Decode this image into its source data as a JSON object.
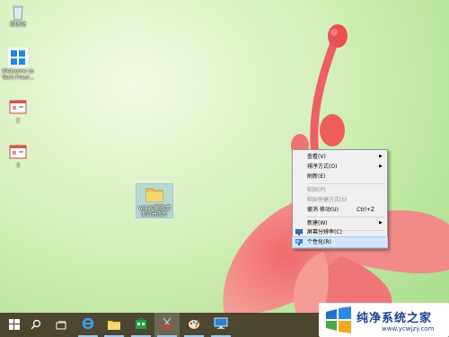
{
  "desktop": {
    "icons": [
      {
        "label": "回收站",
        "icon": "recycle-bin-icon"
      },
      {
        "label": "Welcome to Tech Previ...",
        "icon": "windows-logo-icon"
      },
      {
        "label": "2",
        "icon": "document-icon"
      },
      {
        "label": "3",
        "icon": "document-icon"
      },
      {
        "label": "win10更改桌面背景图片",
        "icon": "folder-icon"
      }
    ]
  },
  "context_menu": {
    "items": [
      {
        "label": "查看(V)",
        "submenu": true,
        "disabled": false
      },
      {
        "label": "排序方式(O)",
        "submenu": true,
        "disabled": false
      },
      {
        "label": "刷新(E)",
        "submenu": false,
        "disabled": false
      },
      {
        "label": "粘贴(P)",
        "submenu": false,
        "disabled": true
      },
      {
        "label": "粘贴快捷方式(S)",
        "submenu": false,
        "disabled": true
      },
      {
        "label": "撤消 移动(U)",
        "shortcut": "Ctrl+Z",
        "submenu": false,
        "disabled": false
      },
      {
        "label": "新建(W)",
        "submenu": true,
        "disabled": false
      },
      {
        "label": "屏幕分辨率(C)",
        "submenu": false,
        "disabled": false,
        "icon": "display-icon"
      },
      {
        "label": "个性化(R)",
        "submenu": false,
        "disabled": false,
        "icon": "personalize-icon",
        "highlighted": true
      }
    ]
  },
  "taskbar": {
    "buttons": [
      {
        "name": "start-button",
        "icon": "windows-start-icon"
      },
      {
        "name": "search-button",
        "icon": "search-icon"
      },
      {
        "name": "task-view-button",
        "icon": "task-view-icon"
      },
      {
        "name": "ie-button",
        "icon": "internet-explorer-icon"
      },
      {
        "name": "file-explorer-button",
        "icon": "folder-icon"
      },
      {
        "name": "store-button",
        "icon": "store-icon"
      },
      {
        "name": "snipping-tool-button",
        "icon": "scissors-icon"
      },
      {
        "name": "paint-button",
        "icon": "paint-icon"
      },
      {
        "name": "remote-desktop-button",
        "icon": "monitor-icon"
      }
    ]
  },
  "watermark": {
    "title": "纯净系统之家",
    "url": "www.ycwjzy.com"
  },
  "colors": {
    "menu_bg": "#f0f0f0",
    "highlight": "#d5e7f8",
    "taskbar": "#423828",
    "watermark_text": "#1b3f8f"
  }
}
